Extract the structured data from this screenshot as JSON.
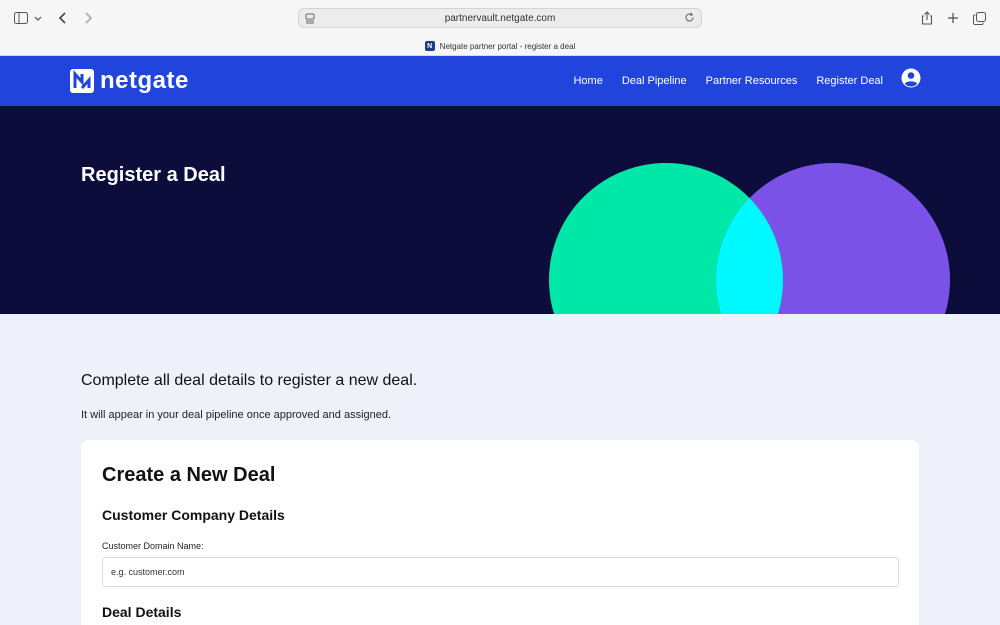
{
  "browser": {
    "url": "partnervault.netgate.com",
    "tab_title": "Netgate partner portal - register a deal"
  },
  "nav": {
    "logo_text": "netgate",
    "links": [
      "Home",
      "Deal Pipeline",
      "Partner Resources",
      "Register Deal"
    ]
  },
  "hero": {
    "title": "Register a Deal"
  },
  "intro": {
    "lead": "Complete all deal details to register a new deal.",
    "sub": "It will appear in your deal pipeline once approved and assigned."
  },
  "form": {
    "title": "Create a New Deal",
    "section_company": "Customer Company Details",
    "domain_label": "Customer Domain Name:",
    "domain_placeholder": "e.g. customer.com",
    "section_deal": "Deal Details"
  },
  "colors": {
    "nav_blue": "#2145dc",
    "hero_navy": "#0d0d3c",
    "circle_green": "#00e8a8",
    "circle_purple": "#7a52e8",
    "circle_overlap": "#00f8ff"
  }
}
